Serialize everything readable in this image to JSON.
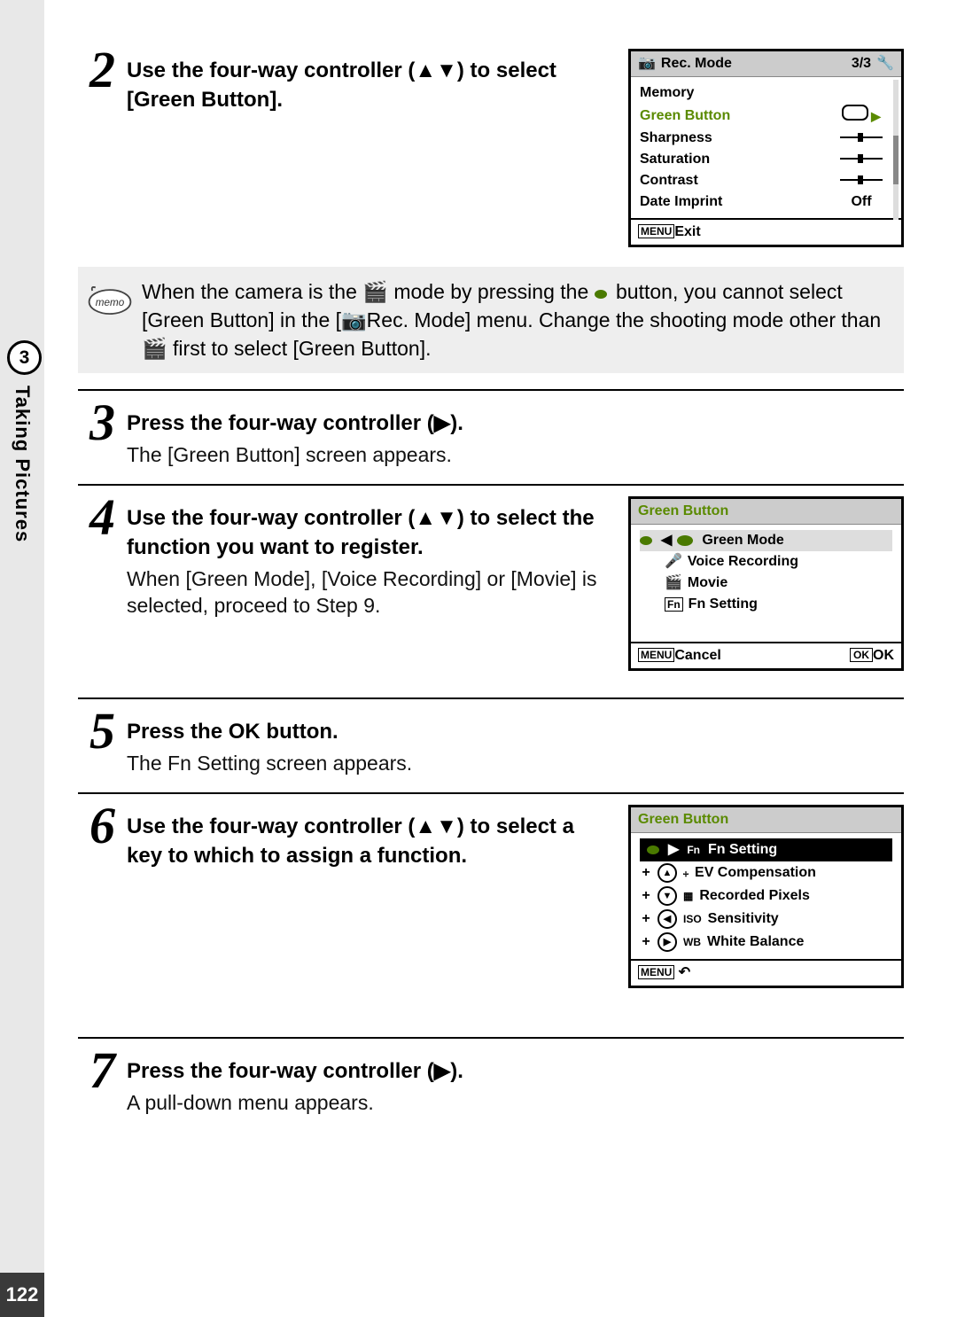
{
  "chapter_number": "3",
  "side_label": "Taking Pictures",
  "page_number": "122",
  "steps": {
    "s2": {
      "num": "2",
      "title": "Use the four-way controller (▲▼) to select [Green Button]."
    },
    "s3": {
      "num": "3",
      "title": "Press the four-way controller (▶).",
      "desc": "The [Green Button] screen appears."
    },
    "s4": {
      "num": "4",
      "title": "Use the four-way controller (▲▼) to select the function you want to register.",
      "desc": "When [Green Mode], [Voice Recording] or [Movie] is selected, proceed to Step 9."
    },
    "s5": {
      "num": "5",
      "title_pre": "Press the ",
      "title_ok": "OK",
      "title_post": "  button.",
      "desc": "The Fn Setting screen appears."
    },
    "s6": {
      "num": "6",
      "title": "Use the four-way controller (▲▼) to select a key to which to assign a function."
    },
    "s7": {
      "num": "7",
      "title": "Press the four-way controller (▶).",
      "desc": "A pull-down menu appears."
    }
  },
  "memo": {
    "label": "memo",
    "text_a": "When the camera is the ",
    "text_b": " mode by pressing the ",
    "text_c": " button, you cannot select [Green Button] in the [",
    "text_d": "Rec. Mode] menu. Change the shooting mode other than ",
    "text_e": " first to select [Green Button]."
  },
  "screen1": {
    "title": "Rec. Mode",
    "page": "3/3",
    "rows": [
      {
        "label": "Memory",
        "val": ""
      },
      {
        "label": "Green Button",
        "val": "cap"
      },
      {
        "label": "Sharpness",
        "val": "slider"
      },
      {
        "label": "Saturation",
        "val": "slider"
      },
      {
        "label": "Contrast",
        "val": "slider"
      },
      {
        "label": "Date Imprint",
        "val": "Off"
      }
    ],
    "footer": "Exit",
    "menu": "MENU"
  },
  "screen2": {
    "title": "Green Button",
    "options": [
      {
        "label": "Green Mode",
        "sel": true,
        "icon": "green"
      },
      {
        "label": "Voice Recording",
        "icon": "mic"
      },
      {
        "label": "Movie",
        "icon": "movie"
      },
      {
        "label": "Fn Setting",
        "icon": "fn"
      }
    ],
    "menu": "MENU",
    "cancel": "Cancel",
    "ok": "OK",
    "okbtn": "OK"
  },
  "screen3": {
    "title": "Green Button",
    "topline": "Fn Setting",
    "fn": "Fn",
    "rows": [
      {
        "key": "▲",
        "icon": "EV",
        "label": "EV Compensation"
      },
      {
        "key": "▼",
        "icon": "px",
        "label": "Recorded Pixels"
      },
      {
        "key": "◀",
        "icon": "ISO",
        "label": "Sensitivity"
      },
      {
        "key": "▶",
        "icon": "WB",
        "label": "White Balance"
      }
    ],
    "menu": "MENU"
  }
}
